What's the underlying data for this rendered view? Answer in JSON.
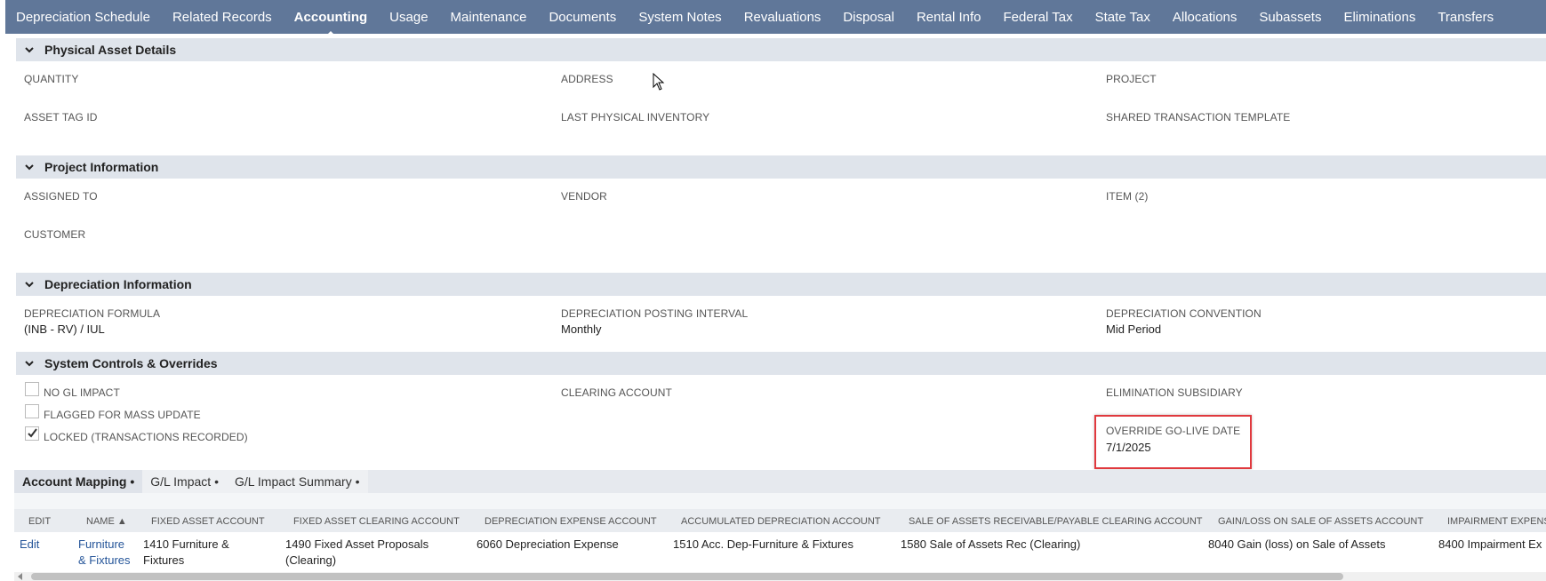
{
  "tabs": [
    {
      "label": "Depreciation Schedule",
      "active": false
    },
    {
      "label": "Related Records",
      "active": false
    },
    {
      "label": "Accounting",
      "active": true
    },
    {
      "label": "Usage",
      "active": false
    },
    {
      "label": "Maintenance",
      "active": false
    },
    {
      "label": "Documents",
      "active": false
    },
    {
      "label": "System Notes",
      "active": false
    },
    {
      "label": "Revaluations",
      "active": false
    },
    {
      "label": "Disposal",
      "active": false
    },
    {
      "label": "Rental Info",
      "active": false
    },
    {
      "label": "Federal Tax",
      "active": false
    },
    {
      "label": "State Tax",
      "active": false
    },
    {
      "label": "Allocations",
      "active": false
    },
    {
      "label": "Subassets",
      "active": false
    },
    {
      "label": "Eliminations",
      "active": false
    },
    {
      "label": "Transfers",
      "active": false
    }
  ],
  "sections": {
    "physical": {
      "title": "Physical Asset Details",
      "quantity_label": "QUANTITY",
      "address_label": "ADDRESS",
      "project_label": "PROJECT",
      "asset_tag_label": "ASSET TAG ID",
      "last_inventory_label": "LAST PHYSICAL INVENTORY",
      "shared_template_label": "SHARED TRANSACTION TEMPLATE"
    },
    "project": {
      "title": "Project Information",
      "assigned_to_label": "ASSIGNED TO",
      "vendor_label": "VENDOR",
      "item_label": "ITEM (2)",
      "customer_label": "CUSTOMER"
    },
    "depreciation": {
      "title": "Depreciation Information",
      "formula_label": "DEPRECIATION FORMULA",
      "formula_value": "(INB - RV) / IUL",
      "interval_label": "DEPRECIATION POSTING INTERVAL",
      "interval_value": "Monthly",
      "convention_label": "DEPRECIATION CONVENTION",
      "convention_value": "Mid Period"
    },
    "controls": {
      "title": "System Controls & Overrides",
      "no_gl_label": "NO GL IMPACT",
      "no_gl_checked": false,
      "flagged_label": "FLAGGED FOR MASS UPDATE",
      "flagged_checked": false,
      "locked_label": "LOCKED (TRANSACTIONS RECORDED)",
      "locked_checked": true,
      "clearing_account_label": "CLEARING ACCOUNT",
      "elimination_subsidiary_label": "ELIMINATION SUBSIDIARY",
      "override_label": "OVERRIDE GO-LIVE DATE",
      "override_value": "7/1/2025"
    }
  },
  "subtabs": [
    {
      "label": "Account Mapping •",
      "active": true
    },
    {
      "label": "G/L Impact •",
      "active": false
    },
    {
      "label": "G/L Impact Summary •",
      "active": false
    }
  ],
  "table": {
    "headers": {
      "edit": "EDIT",
      "name": "NAME ▲",
      "fixed_asset_account": "FIXED ASSET ACCOUNT",
      "fixed_asset_clearing": "FIXED ASSET CLEARING ACCOUNT",
      "depreciation_expense": "DEPRECIATION EXPENSE ACCOUNT",
      "accumulated_depreciation": "ACCUMULATED DEPRECIATION ACCOUNT",
      "sale_clearing": "SALE OF ASSETS RECEIVABLE/PAYABLE CLEARING ACCOUNT",
      "gain_loss": "GAIN/LOSS ON SALE OF ASSETS ACCOUNT",
      "impairment": "IMPAIRMENT EXPENSE"
    },
    "row": {
      "edit": "Edit",
      "name_line1": "Furniture",
      "name_line2": "& Fixtures",
      "fixed_asset_line1": "1410 Furniture &",
      "fixed_asset_line2": "Fixtures",
      "clearing_line1": "1490 Fixed Asset Proposals",
      "clearing_line2": "(Clearing)",
      "depreciation_expense": "6060 Depreciation Expense",
      "accumulated": "1510 Acc. Dep-Furniture & Fixtures",
      "sale_clearing": "1580 Sale of Assets Rec (Clearing)",
      "gain_loss": "8040 Gain (loss) on Sale of Assets",
      "impairment": "8400 Impairment Ex"
    }
  },
  "colors": {
    "topbar": "#607799",
    "section_header": "#dfe4eb",
    "highlight": "#e0393e",
    "link": "#255599"
  }
}
